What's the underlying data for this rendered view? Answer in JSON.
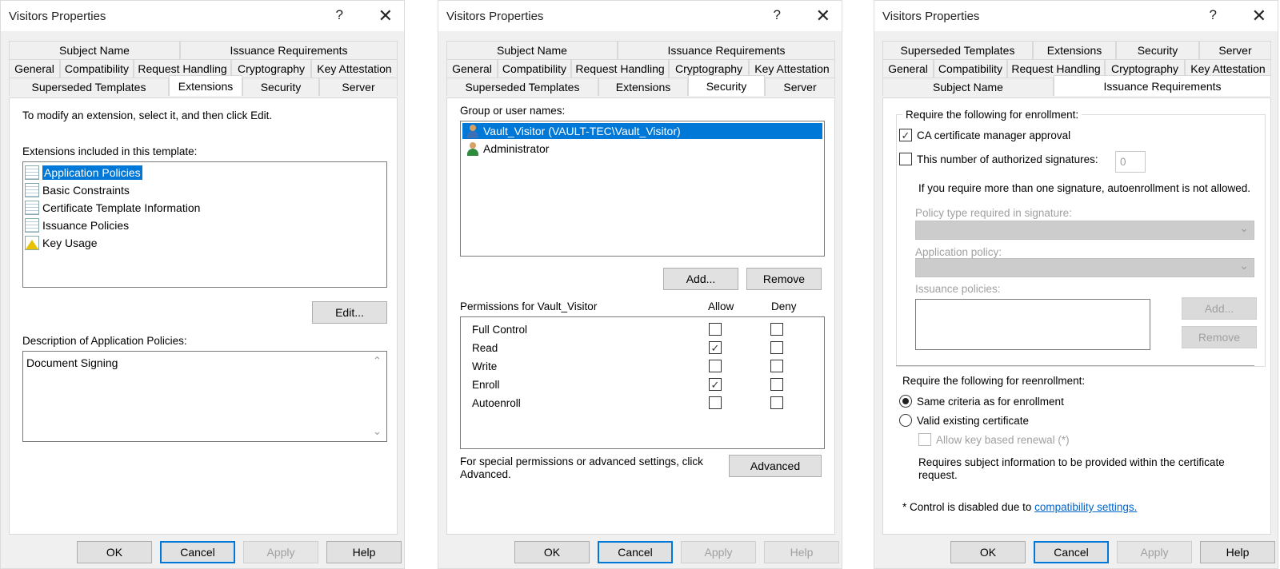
{
  "dialogs": {
    "d1": {
      "title": "Visitors Properties",
      "help": "?",
      "close": "✕",
      "tabs": {
        "row1": [
          "Subject Name",
          "Issuance Requirements"
        ],
        "row2": [
          "General",
          "Compatibility",
          "Request Handling",
          "Cryptography",
          "Key Attestation"
        ],
        "row3": [
          "Superseded Templates",
          "Extensions",
          "Security",
          "Server"
        ]
      },
      "selected_tab": "Extensions",
      "instructions": "To modify an extension, select it, and then click Edit.",
      "list_label": "Extensions included in this template:",
      "extensions": [
        "Application Policies",
        "Basic Constraints",
        "Certificate Template Information",
        "Issuance Policies",
        "Key Usage"
      ],
      "edit_button": "Edit...",
      "description_label": "Description of Application Policies:",
      "description": "Document Signing",
      "scroll_up": "⌃",
      "scroll_down": "⌄"
    },
    "d2": {
      "title": "Visitors Properties",
      "help": "?",
      "close": "✕",
      "tabs": {
        "row1": [
          "Subject Name",
          "Issuance Requirements"
        ],
        "row2": [
          "General",
          "Compatibility",
          "Request Handling",
          "Cryptography",
          "Key Attestation"
        ],
        "row3": [
          "Superseded Templates",
          "Extensions",
          "Security",
          "Server"
        ]
      },
      "selected_tab": "Security",
      "group_label": "Group or user names:",
      "users": [
        "Vault_Visitor (VAULT-TEC\\Vault_Visitor)",
        "Administrator"
      ],
      "add_button": "Add...",
      "remove_button": "Remove",
      "perm_label": "Permissions for Vault_Visitor",
      "allow_header": "Allow",
      "deny_header": "Deny",
      "permissions": [
        {
          "name": "Full Control",
          "allow": "",
          "deny": ""
        },
        {
          "name": "Read",
          "allow": "✓",
          "deny": ""
        },
        {
          "name": "Write",
          "allow": "",
          "deny": ""
        },
        {
          "name": "Enroll",
          "allow": "✓",
          "deny": ""
        },
        {
          "name": "Autoenroll",
          "allow": "",
          "deny": ""
        }
      ],
      "special_line1": "For special permissions or advanced settings, click",
      "special_line2": "Advanced.",
      "advanced_button": "Advanced"
    },
    "d3": {
      "title": "Visitors Properties",
      "help": "?",
      "close": "✕",
      "tabs": {
        "row1": [
          "Superseded Templates",
          "Extensions",
          "Security",
          "Server"
        ],
        "row2": [
          "General",
          "Compatibility",
          "Request Handling",
          "Cryptography",
          "Key Attestation"
        ],
        "row3": [
          "Subject Name",
          "Issuance Requirements"
        ]
      },
      "selected_tab": "Issuance Requirements",
      "enroll_group": "Require the following for enrollment:",
      "ca_approval": "CA certificate manager approval",
      "ca_approval_check": "✓",
      "num_signatures": "This number of authorized signatures:",
      "num_signatures_value": "0",
      "signature_note": "If you require more than one signature, autoenrollment is not allowed.",
      "policy_type_label": "Policy type required in signature:",
      "app_policy_label": "Application policy:",
      "issuance_label": "Issuance policies:",
      "add_button": "Add...",
      "remove_button": "Remove",
      "reenroll_group": "Require the following for reenrollment:",
      "same_criteria": "Same criteria as for enrollment",
      "valid_cert": "Valid existing certificate",
      "allow_key": "Allow key based renewal (*)",
      "subject_note_1": "Requires subject information to be provided within the certificate",
      "subject_note_2": "request.",
      "control_note": "* Control is disabled due to ",
      "compat_link": "compatibility settings."
    }
  },
  "footer": {
    "ok": "OK",
    "cancel": "Cancel",
    "apply": "Apply",
    "help": "Help"
  }
}
